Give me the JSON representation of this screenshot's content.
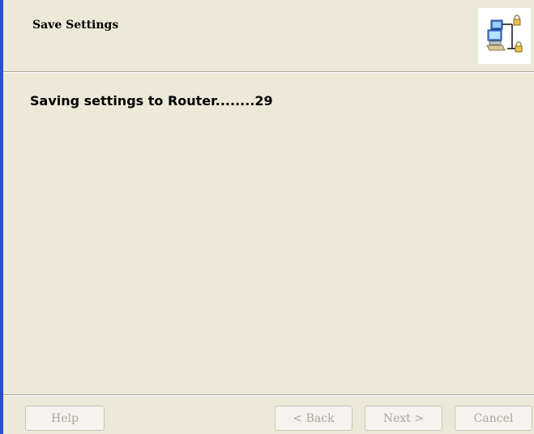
{
  "header": {
    "title": "Save Settings",
    "icon": "network-computer-lock-icon"
  },
  "content": {
    "status": "Saving settings to Router........29"
  },
  "footer": {
    "help_label": "Help",
    "back_label": "< Back",
    "next_label": "Next >",
    "cancel_label": "Cancel",
    "buttons_disabled": true
  },
  "colors": {
    "window_border": "#2a4fd6",
    "background": "#ece9d8",
    "disabled_text": "#aca899"
  }
}
